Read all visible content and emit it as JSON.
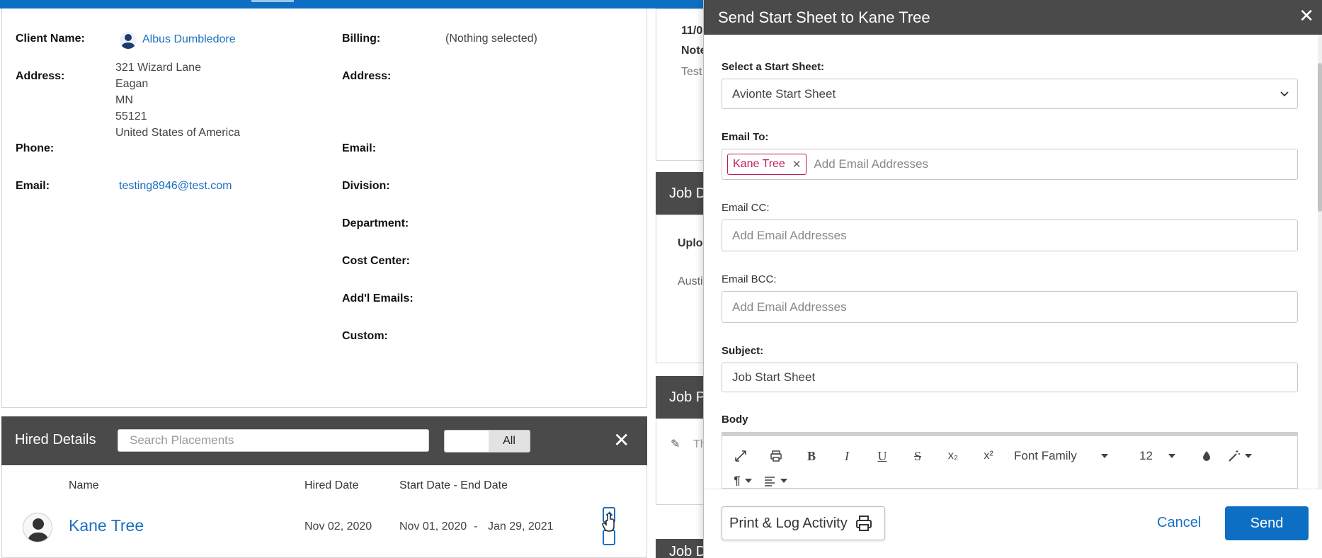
{
  "client": {
    "client_name_label": "Client Name:",
    "client_name": "Albus Dumbledore",
    "address_label": "Address:",
    "address_lines": [
      "321 Wizard Lane",
      "Eagan",
      "MN",
      "55121",
      "United States of America"
    ],
    "phone_label": "Phone:",
    "email_label": "Email:",
    "email": "testing8946@test.com",
    "billing_label": "Billing:",
    "billing_value": "(Nothing selected)",
    "billing_address_label": "Address:",
    "billing_email_label": "Email:",
    "division_label": "Division:",
    "department_label": "Department:",
    "cost_center_label": "Cost Center:",
    "addl_emails_label": "Add'l Emails:",
    "custom_label": "Custom:"
  },
  "hired": {
    "title": "Hired Details",
    "search_placeholder": "Search Placements",
    "toggle_all": "All",
    "columns": [
      "Name",
      "Hired Date",
      "Start Date - End Date"
    ],
    "rows": [
      {
        "name": "Kane Tree",
        "hired_date": "Nov 02, 2020",
        "start_date": "Nov 01, 2020",
        "sep": "-",
        "end_date": "Jan 29, 2021"
      }
    ]
  },
  "background": {
    "date_fragment": "11/0",
    "notes_fragment": "Note",
    "test_fragment": "Test",
    "job_d": "Job D",
    "upload_fragment": "Uploa",
    "austin_fragment": "Austi",
    "job_p": "Job P",
    "th_fragment": "Th",
    "bottom_fragment": "Job D"
  },
  "modal": {
    "title": "Send Start Sheet to Kane Tree",
    "close": "✕",
    "select_label": "Select a Start Sheet:",
    "select_value": "Avionte Start Sheet",
    "email_to_label": "Email To:",
    "email_to_tag": "Kane Tree",
    "email_to_placeholder": "Add Email Addresses",
    "email_cc_label": "Email CC:",
    "email_cc_placeholder": "Add Email Addresses",
    "email_bcc_label": "Email BCC:",
    "email_bcc_placeholder": "Add Email Addresses",
    "subject_label": "Subject:",
    "subject_value": "Job Start Sheet",
    "body_label": "Body",
    "toolbar": {
      "bold": "B",
      "italic": "I",
      "underline": "U",
      "strike": "S",
      "subscript": "x₂",
      "superscript": "x²",
      "font_family": "Font Family",
      "font_size": "12"
    },
    "print_label": "Print & Log Activity",
    "cancel_label": "Cancel",
    "send_label": "Send"
  },
  "colors": {
    "accent": "#0d6fc4",
    "header": "#4a4a4a",
    "tag": "#c2185b",
    "link": "#1b6fc0"
  }
}
